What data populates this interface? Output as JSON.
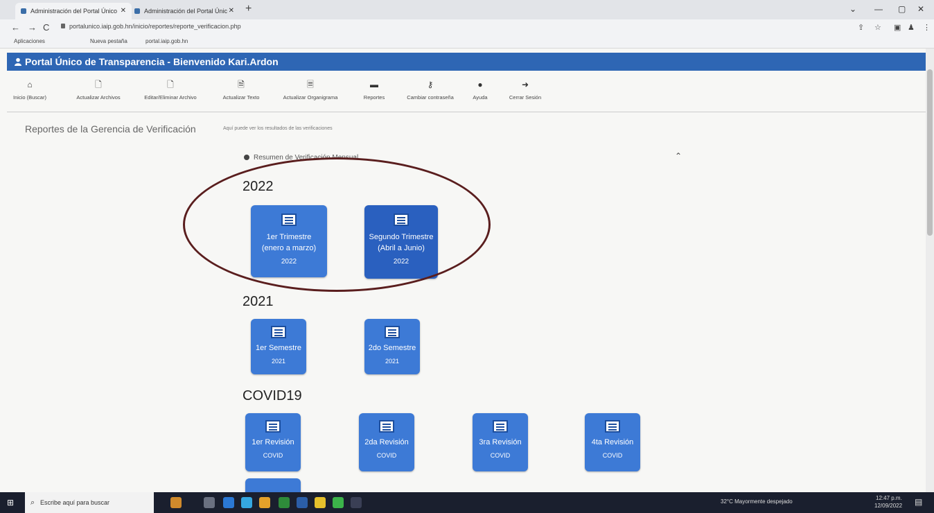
{
  "browser": {
    "tabs": [
      {
        "label": "Administración del Portal Único"
      },
      {
        "label": "Administración del Portal Únic"
      }
    ],
    "new_tab": "+",
    "win_controls": [
      "⌄",
      "—",
      "▢",
      "✕"
    ],
    "url": "portalunico.iaip.gob.hn/inicio/reportes/reporte_verificacion.php",
    "bookmarks": [
      "Aplicaciones",
      "Nueva pestaña",
      "portal.iaip.gob.hn"
    ]
  },
  "portal": {
    "header_title": "Portal Único de Transparencia - Bienvenido Kari.Ardon",
    "toolbar": [
      {
        "icon": "home-icon",
        "glyph": "⌂",
        "label": "Inicio (Buscar)"
      },
      {
        "icon": "file-icon",
        "glyph": "🗋",
        "label": "Actualizar Archivos"
      },
      {
        "icon": "file-edit-icon",
        "glyph": "🗋",
        "label": "Editar/Eliminar Archivo"
      },
      {
        "icon": "text-icon",
        "glyph": "🗎",
        "label": "Actualizar Texto"
      },
      {
        "icon": "org-chart-icon",
        "glyph": "🗏",
        "label": "Actualizar Organigrama"
      },
      {
        "icon": "reports-icon",
        "glyph": "▬",
        "label": "Reportes"
      },
      {
        "icon": "key-icon",
        "glyph": "⚷",
        "label": "Cambiar contraseña"
      },
      {
        "icon": "help-icon",
        "glyph": "●",
        "label": "Ayuda"
      },
      {
        "icon": "logout-icon",
        "glyph": "➜",
        "label": "Cerrar Sesión"
      }
    ],
    "section_title": "Reportes de la Gerencia de Verificación",
    "section_subtitle": "Aquí puede ver los resultados de las verificaciones",
    "panel_title": "Resumen de Verificación Mensual",
    "groups": [
      {
        "year": "2022",
        "cards": [
          {
            "line1": "1er Trimestre",
            "line2": "(enero a marzo)",
            "line3": "2022"
          },
          {
            "line1": "Segundo Trimestre",
            "line2": "(Abril a Junio)",
            "line3": "2022"
          }
        ]
      },
      {
        "year": "2021",
        "cards": [
          {
            "line1": "1er Semestre",
            "line2": "2021"
          },
          {
            "line1": "2do Semestre",
            "line2": "2021"
          }
        ]
      },
      {
        "year": "COVID19",
        "cards": [
          {
            "line1": "1er Revisión",
            "line2": "COVID"
          },
          {
            "line1": "2da Revisión",
            "line2": "COVID"
          },
          {
            "line1": "3ra Revisión",
            "line2": "COVID"
          },
          {
            "line1": "4ta Revisión",
            "line2": "COVID"
          }
        ]
      }
    ]
  },
  "taskbar": {
    "search_placeholder": "Escribe aquí para buscar",
    "weather": "32°C Mayormente despejado",
    "time": "12:47 p.m.",
    "date": "12/09/2022"
  },
  "colors": {
    "header_blue": "#2e66b4",
    "card_blue": "#3d7ad6",
    "card_dark": "#2a60bf",
    "annotation": "#5a1e1e"
  }
}
